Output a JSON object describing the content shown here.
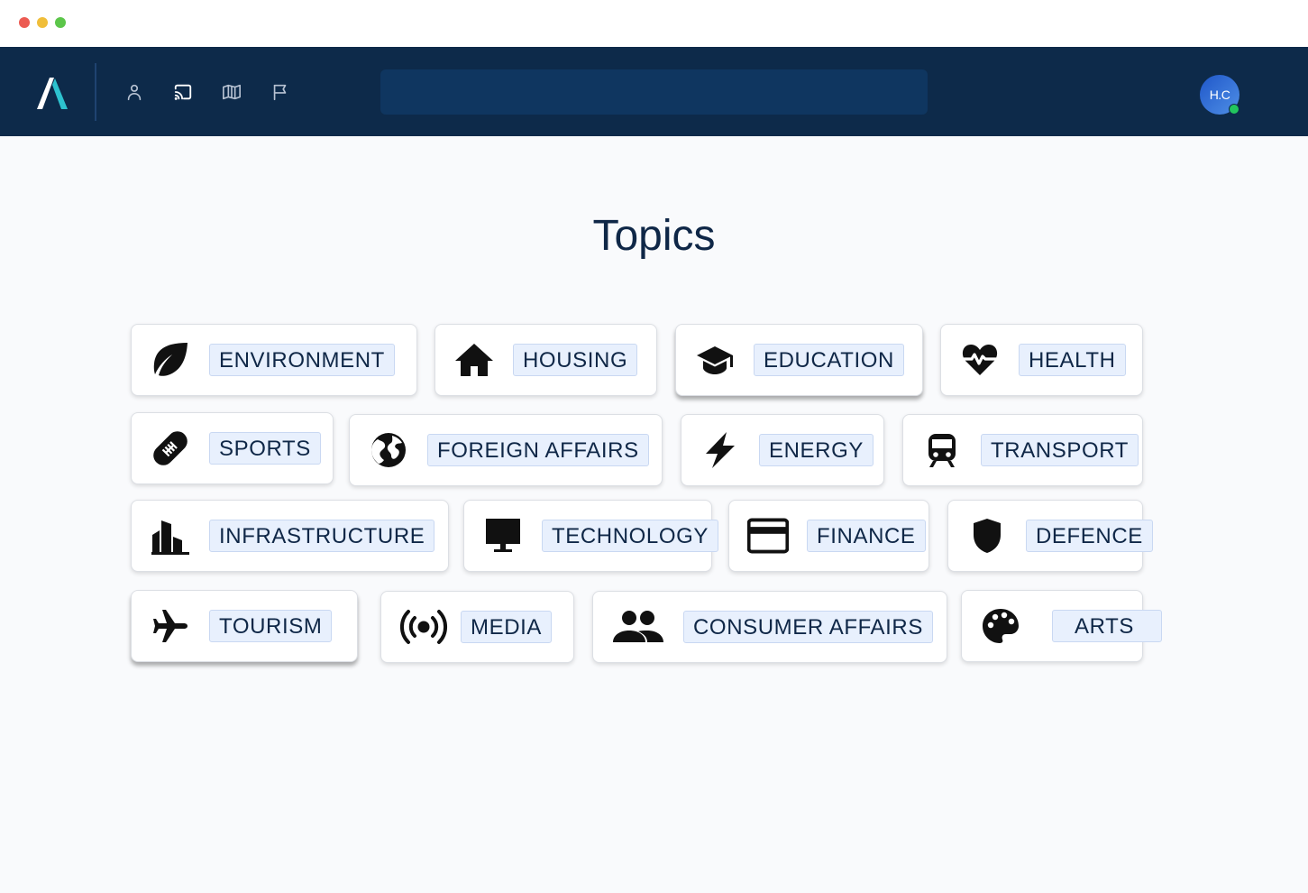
{
  "header": {
    "avatar_initials": "H.C",
    "presence_color": "#22c55e",
    "nav_icons": [
      "person-icon",
      "cast-icon",
      "map-icon",
      "flag-icon"
    ]
  },
  "search": {
    "value": "",
    "placeholder": ""
  },
  "page": {
    "title": "Topics"
  },
  "topics": [
    {
      "label": "ENVIRONMENT",
      "icon": "leaf-icon"
    },
    {
      "label": "HOUSING",
      "icon": "house-icon"
    },
    {
      "label": "EDUCATION",
      "icon": "graduation-cap-icon"
    },
    {
      "label": "HEALTH",
      "icon": "heartbeat-icon"
    },
    {
      "label": "SPORTS",
      "icon": "football-icon"
    },
    {
      "label": "FOREIGN AFFAIRS",
      "icon": "globe-icon"
    },
    {
      "label": "ENERGY",
      "icon": "lightning-icon"
    },
    {
      "label": "TRANSPORT",
      "icon": "train-icon"
    },
    {
      "label": "INFRASTRUCTURE",
      "icon": "buildings-icon"
    },
    {
      "label": "TECHNOLOGY",
      "icon": "monitor-icon"
    },
    {
      "label": "FINANCE",
      "icon": "credit-card-icon"
    },
    {
      "label": "DEFENCE",
      "icon": "shield-icon"
    },
    {
      "label": "TOURISM",
      "icon": "airplane-icon"
    },
    {
      "label": "MEDIA",
      "icon": "broadcast-icon"
    },
    {
      "label": "CONSUMER AFFAIRS",
      "icon": "people-icon"
    },
    {
      "label": "ARTS",
      "icon": "palette-icon"
    }
  ],
  "colors": {
    "navbar": "#0d2a4a",
    "search_bg": "#0f3660",
    "label_bg": "#e8f0fd",
    "text": "#0f2747"
  }
}
